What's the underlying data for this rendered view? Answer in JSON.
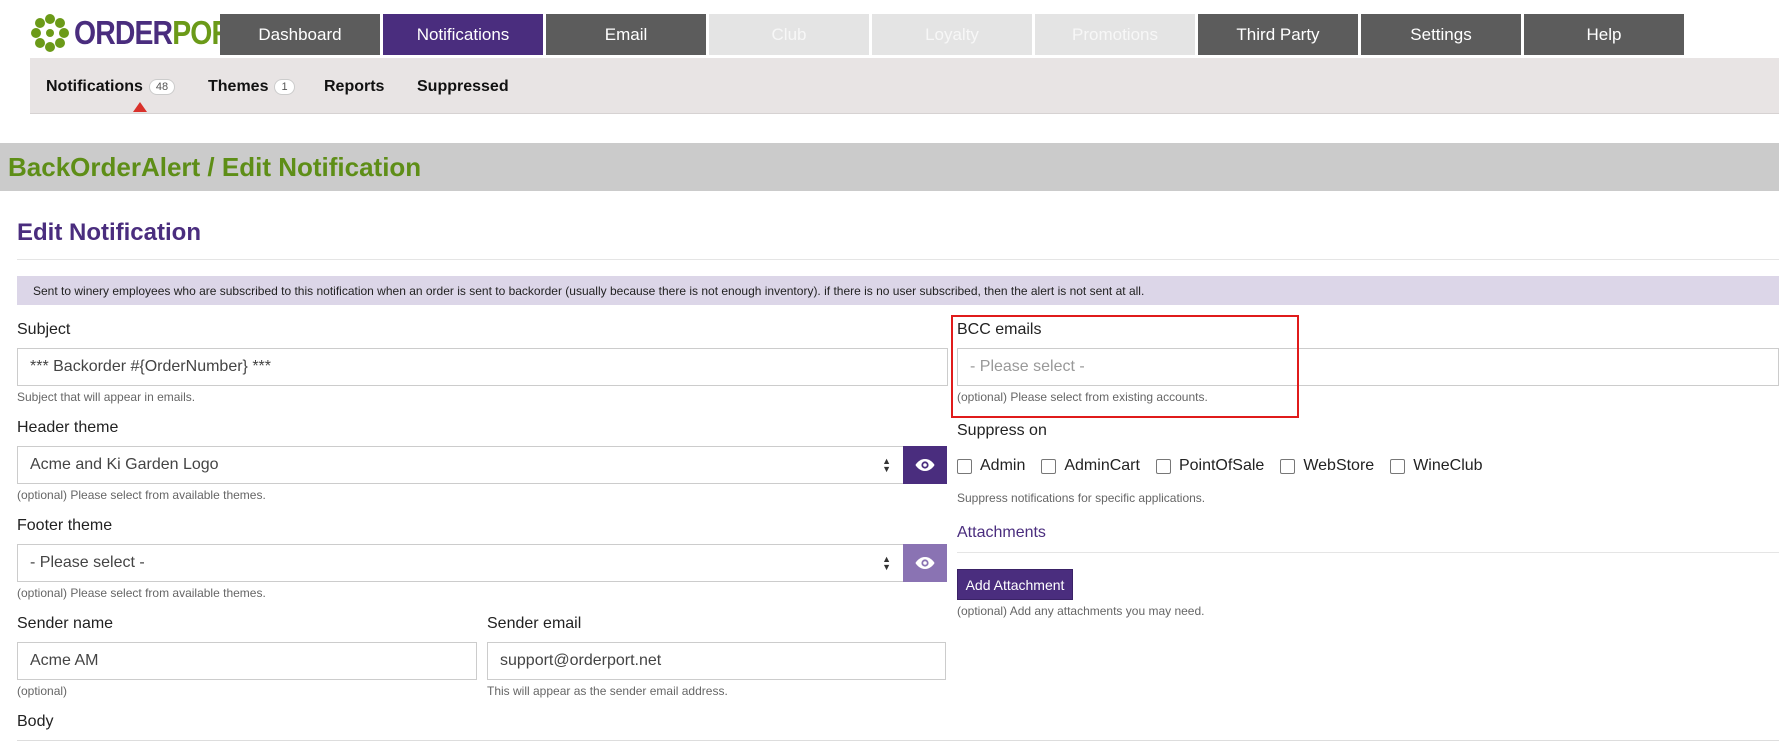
{
  "logo": {
    "part1": "ORDER",
    "part2": "PORT"
  },
  "main_nav": [
    {
      "label": "Dashboard",
      "state": "normal"
    },
    {
      "label": "Notifications",
      "state": "active"
    },
    {
      "label": "Email",
      "state": "normal"
    },
    {
      "label": "Club",
      "state": "disabled"
    },
    {
      "label": "Loyalty",
      "state": "disabled"
    },
    {
      "label": "Promotions",
      "state": "disabled"
    },
    {
      "label": "Third Party",
      "state": "normal"
    },
    {
      "label": "Settings",
      "state": "normal"
    },
    {
      "label": "Help",
      "state": "normal"
    }
  ],
  "sub_nav": {
    "notifications": {
      "label": "Notifications",
      "count": "48"
    },
    "themes": {
      "label": "Themes",
      "count": "1"
    },
    "reports": {
      "label": "Reports"
    },
    "suppressed": {
      "label": "Suppressed"
    }
  },
  "page_title": "BackOrderAlert / Edit Notification",
  "section_title": "Edit Notification",
  "info_text": "Sent to winery employees who are subscribed to this notification when an order is sent to backorder (usually because there is not enough inventory). if there is no user subscribed, then the alert is not sent at all.",
  "subject": {
    "label": "Subject",
    "value": "***  Backorder #{OrderNumber} ***",
    "help": "Subject that will appear in emails."
  },
  "header_theme": {
    "label": "Header theme",
    "value": "Acme and Ki Garden Logo",
    "help": "(optional) Please select from available themes."
  },
  "footer_theme": {
    "label": "Footer theme",
    "value": "- Please select -",
    "help": "(optional) Please select from available themes."
  },
  "sender_name": {
    "label": "Sender name",
    "value": "Acme AM",
    "help": "(optional)"
  },
  "sender_email": {
    "label": "Sender email",
    "value": "support@orderport.net",
    "help": "This will appear as the sender email address."
  },
  "body": {
    "label": "Body"
  },
  "bcc_emails": {
    "label": "BCC emails",
    "placeholder": "- Please select -",
    "help": "(optional) Please select from existing accounts."
  },
  "suppress_on": {
    "label": "Suppress on",
    "options": [
      "Admin",
      "AdminCart",
      "PointOfSale",
      "WebStore",
      "WineClub"
    ],
    "help": "Suppress notifications for specific applications."
  },
  "attachments": {
    "label": "Attachments",
    "button": "Add Attachment",
    "help": "(optional) Add any attachments you may need."
  },
  "colors": {
    "brand_purple": "#4a2d7e",
    "brand_green": "#5e8e17",
    "highlight_red": "#e01b1b"
  }
}
